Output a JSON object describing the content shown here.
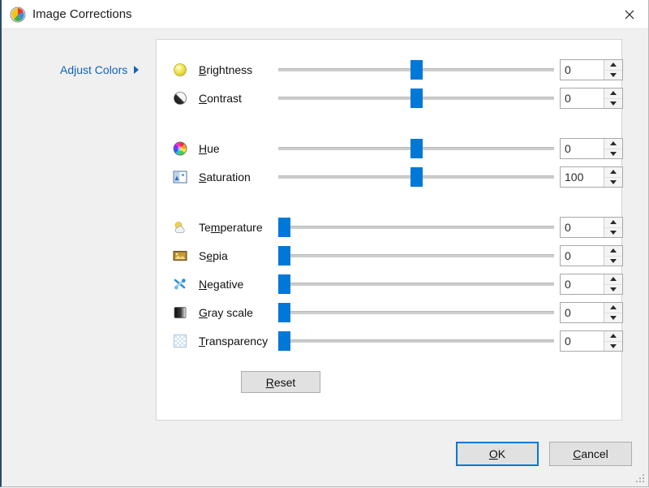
{
  "window": {
    "title": "Image Corrections",
    "icon": "color-palette-icon",
    "close_icon": "close-icon"
  },
  "nav": {
    "adjust_colors": {
      "label": "Adjust Colors",
      "arrow_icon": "chevron-right-icon"
    }
  },
  "controls": [
    {
      "id": "brightness",
      "icon": "brightness-icon",
      "label_prefix": "",
      "accel": "B",
      "label_suffix": "rightness",
      "value": "0",
      "slider_percent": 50
    },
    {
      "id": "contrast",
      "icon": "contrast-icon",
      "label_prefix": "",
      "accel": "C",
      "label_suffix": "ontrast",
      "value": "0",
      "slider_percent": 50
    },
    {
      "id": "hue",
      "icon": "hue-wheel-icon",
      "label_prefix": "",
      "accel": "H",
      "label_suffix": "ue",
      "value": "0",
      "slider_percent": 50
    },
    {
      "id": "saturation",
      "icon": "saturation-icon",
      "label_prefix": "",
      "accel": "S",
      "label_suffix": "aturation",
      "value": "100",
      "slider_percent": 50
    },
    {
      "id": "temperature",
      "icon": "temperature-icon",
      "label_prefix": "Te",
      "accel": "m",
      "label_suffix": "perature",
      "value": "0",
      "slider_percent": 0
    },
    {
      "id": "sepia",
      "icon": "sepia-icon",
      "label_prefix": "S",
      "accel": "e",
      "label_suffix": "pia",
      "value": "0",
      "slider_percent": 0
    },
    {
      "id": "negative",
      "icon": "negative-icon",
      "label_prefix": "",
      "accel": "N",
      "label_suffix": "egative",
      "value": "0",
      "slider_percent": 0
    },
    {
      "id": "gray-scale",
      "icon": "grayscale-icon",
      "label_prefix": "",
      "accel": "G",
      "label_suffix": "ray scale",
      "value": "0",
      "slider_percent": 0
    },
    {
      "id": "transparency",
      "icon": "transparency-icon",
      "label_prefix": "",
      "accel": "T",
      "label_suffix": "ransparency",
      "value": "0",
      "slider_percent": 0
    }
  ],
  "buttons": {
    "reset": {
      "accel": "R",
      "suffix": "eset"
    },
    "ok": {
      "accel": "O",
      "suffix": "K"
    },
    "cancel": {
      "accel": "C",
      "suffix": "ancel"
    }
  },
  "colors": {
    "accent": "#0078d7",
    "link": "#1163b8",
    "dialog_bg": "#f0f0f0",
    "panel_bg": "#ffffff"
  }
}
